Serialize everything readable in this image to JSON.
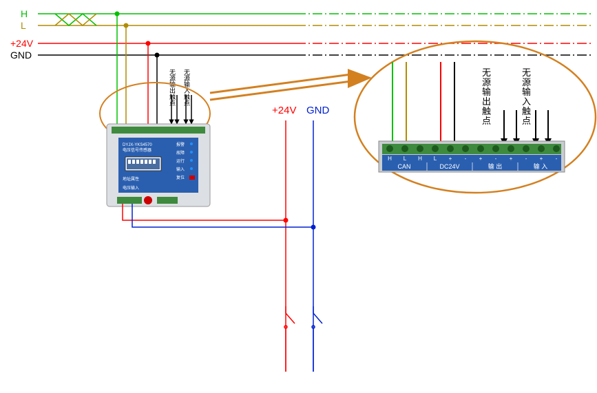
{
  "bus": {
    "H": "H",
    "L": "L",
    "p24": "+24V",
    "gnd": "GND"
  },
  "colors": {
    "H": "#00c000",
    "L": "#b08c00",
    "p24": "#ff0000",
    "gnd": "#000000",
    "mid_gnd": "#0020d0",
    "callout": "#d38020"
  },
  "mid_labels": {
    "p24": "+24V",
    "gnd": "GND"
  },
  "device": {
    "model": "DYJX-YKS4570",
    "subtitle": "电压信号传感器",
    "address_label": "地址属性",
    "bottom_label": "电压输入",
    "side_labels": [
      "报警",
      "故障",
      "运行",
      "输入",
      "复位"
    ]
  },
  "small_annot": {
    "out": "无源输出触点",
    "in": "无源输入触点"
  },
  "detail_annot": {
    "out": "无源输出触点",
    "in": "无源输入触点"
  },
  "detail_strip": {
    "groups": [
      "H",
      "L",
      "H",
      "L",
      "+",
      "-",
      "+",
      "-",
      "+",
      "-",
      "+",
      "-"
    ],
    "row2": [
      "CAN",
      "DC24V",
      "输 出",
      "输 入"
    ]
  }
}
